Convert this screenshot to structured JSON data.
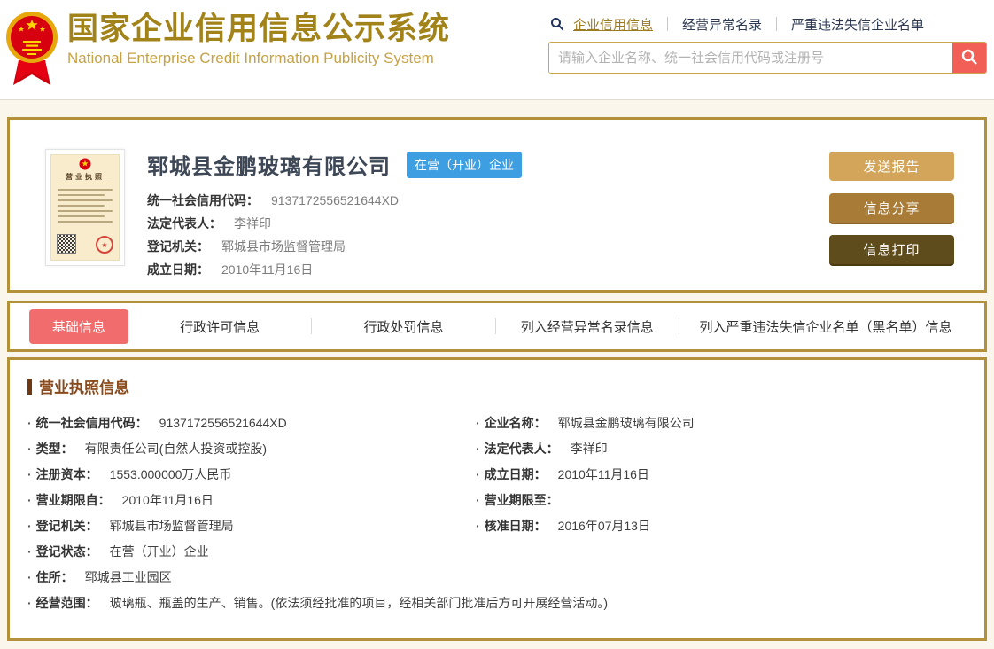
{
  "header": {
    "title_cn": "国家企业信用信息公示系统",
    "title_en": "National Enterprise Credit Information Publicity System",
    "nav": [
      {
        "label": "企业信用信息",
        "active": true
      },
      {
        "label": "经营异常名录",
        "active": false
      },
      {
        "label": "严重违法失信企业名单",
        "active": false
      }
    ],
    "search": {
      "placeholder": "请输入企业名称、统一社会信用代码或注册号"
    }
  },
  "summary": {
    "company_name": "郓城县金鹏玻璃有限公司",
    "status_badge": "在营（开业）企业",
    "license_image_label": "营业执照",
    "fields": [
      {
        "label": "统一社会信用代码：",
        "value": "9137172556521644XD"
      },
      {
        "label": "法定代表人：",
        "value": "李祥印"
      },
      {
        "label": "登记机关：",
        "value": "郓城县市场监督管理局"
      },
      {
        "label": "成立日期：",
        "value": "2010年11月16日"
      }
    ],
    "actions": [
      {
        "label": "发送报告"
      },
      {
        "label": "信息分享"
      },
      {
        "label": "信息打印"
      }
    ]
  },
  "tabs": [
    {
      "label": "基础信息",
      "active": true
    },
    {
      "label": "行政许可信息",
      "active": false
    },
    {
      "label": "行政处罚信息",
      "active": false
    },
    {
      "label": "列入经营异常名录信息",
      "active": false
    },
    {
      "label": "列入严重违法失信企业名单（黑名单）信息",
      "active": false
    }
  ],
  "license_section": {
    "title": "营业执照信息",
    "left": [
      {
        "label": "统一社会信用代码：",
        "value": "9137172556521644XD"
      },
      {
        "label": "类型：",
        "value": "有限责任公司(自然人投资或控股)"
      },
      {
        "label": "注册资本：",
        "value": "1553.000000万人民币"
      },
      {
        "label": "营业期限自：",
        "value": "2010年11月16日"
      },
      {
        "label": "登记机关：",
        "value": "郓城县市场监督管理局"
      },
      {
        "label": "登记状态：",
        "value": "在营（开业）企业"
      },
      {
        "label": "住所：",
        "value": "郓城县工业园区"
      }
    ],
    "right": [
      {
        "label": "企业名称：",
        "value": "郓城县金鹏玻璃有限公司"
      },
      {
        "label": "法定代表人：",
        "value": "李祥印"
      },
      {
        "label": "成立日期：",
        "value": "2010年11月16日"
      },
      {
        "label": "营业期限至：",
        "value": ""
      },
      {
        "label": "核准日期：",
        "value": "2016年07月13日"
      }
    ],
    "full_row": {
      "label": "经营范围：",
      "value": "玻璃瓶、瓶盖的生产、销售。(依法须经批准的项目，经相关部门批准后方可开展经营活动。)"
    }
  },
  "colors": {
    "card_border": "#b3913b",
    "title_gold": "#a2831a",
    "search_button_red": "#f25f57",
    "status_badge_blue": "#3d9ee2",
    "active_tab_red": "#f16c6c",
    "section_title_brown": "#8a4a1c",
    "button_tan": "#d2a55a",
    "button_brown": "#a87c36",
    "button_dark_brown": "#5f4c1c"
  }
}
